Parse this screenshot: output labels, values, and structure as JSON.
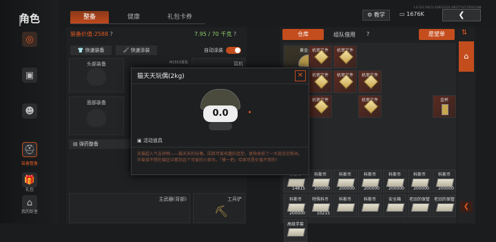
{
  "header": {
    "title": "角色",
    "tabs": [
      "整备",
      "健康",
      "礼包卡券"
    ],
    "active_tab": 0,
    "teach_label": "教学",
    "currency": "1676K",
    "build_info": "1.0.121.191(1) 1Q02/1324 (962771)/17562/1368"
  },
  "sidebar": {
    "items": [
      {
        "label": "",
        "icon": "target-icon"
      },
      {
        "label": "",
        "icon": "cube-icon"
      },
      {
        "label": "",
        "icon": "person-icon"
      },
      {
        "label": "装备整备",
        "icon": "helmet-icon",
        "active": true
      },
      {
        "label": "礼包",
        "icon": "gift-icon"
      },
      {
        "label": "我的卧室",
        "icon": "bed-icon"
      }
    ]
  },
  "equipment": {
    "value_label": "装备价值:",
    "value": "2588",
    "weight": "7.95 / 70 千克",
    "quick_equip": "快速装备",
    "quick_paint": "快速涂装",
    "auto_paint": "自动涂装",
    "slots": {
      "head": "头部装备",
      "face": "面部装备",
      "ammo": "弹药整备",
      "ear": "耳机",
      "ear_tag": "M1553耳机",
      "main_weapon": "主武器(背部)",
      "tool": "工兵铲"
    }
  },
  "warehouse": {
    "tabs": [
      "仓库",
      "组队借用"
    ],
    "wish_label": "愿望单",
    "items": [
      {
        "name": "黄金头盔",
        "type": "helmet",
        "qty": ""
      },
      {
        "name": "机密文件",
        "type": "file",
        "qty": ""
      },
      {
        "name": "机密文件",
        "type": "file",
        "qty": ""
      },
      {
        "name": "机密文件",
        "type": "file",
        "qty": ""
      },
      {
        "name": "机密文件",
        "type": "file",
        "qty": ""
      },
      {
        "name": "机密文件",
        "type": "file",
        "qty": ""
      },
      {
        "name": "机密文件",
        "type": "file",
        "qty": ""
      },
      {
        "name": "机密文件",
        "type": "file",
        "qty": ""
      },
      {
        "name": "金杯",
        "type": "cup",
        "qty": ""
      }
    ],
    "money": [
      {
        "name": "科斯币",
        "qty": "14815"
      },
      {
        "name": "科斯币",
        "qty": "200000"
      },
      {
        "name": "科斯币",
        "qty": "200000"
      },
      {
        "name": "科斯币",
        "qty": "200000"
      },
      {
        "name": "科斯币",
        "qty": "200000"
      },
      {
        "name": "科斯币",
        "qty": "200000"
      },
      {
        "name": "科斯币",
        "qty": "200000"
      },
      {
        "name": "科斯币",
        "qty": "200000"
      },
      {
        "name": "特殊科币",
        "qty": "10215"
      },
      {
        "name": "科斯币",
        "qty": ""
      },
      {
        "name": "科斯币",
        "qty": ""
      },
      {
        "name": "安全箱",
        "qty": ""
      },
      {
        "name": "老旧的保管",
        "qty": ""
      },
      {
        "name": "老旧的保管",
        "qty": ""
      },
      {
        "name": "高级手套",
        "qty": ""
      }
    ]
  },
  "modal": {
    "title": "猫天天玩偶(2kg)",
    "tag": "活动道具",
    "desc": "天猫超人气吉祥物——猫天天的玩偶，因其可爱有趣的造型，很快收获了一大批忠实粉丝。毕竟谁不想在猫区中看到这个可爱的小家伙。「摸一把」哈家可是价值不菲的！"
  }
}
